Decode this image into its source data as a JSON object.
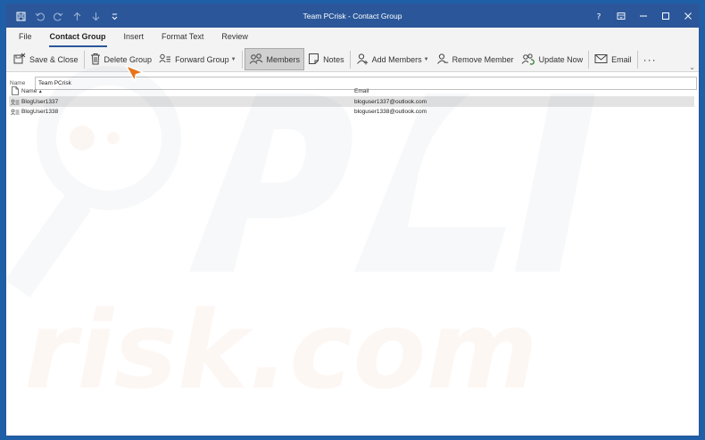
{
  "window": {
    "title": "Team PCrisk  -  Contact Group",
    "controls": [
      "help-icon",
      "ribbon-display-icon",
      "minimize-icon",
      "maximize-icon",
      "close-icon"
    ]
  },
  "quick_access": [
    "save-icon",
    "undo-icon",
    "redo-icon",
    "up-arrow-icon",
    "down-arrow-icon",
    "customize-icon"
  ],
  "tabs": [
    {
      "label": "File"
    },
    {
      "label": "Contact Group",
      "active": true
    },
    {
      "label": "Insert"
    },
    {
      "label": "Format Text"
    },
    {
      "label": "Review"
    }
  ],
  "ribbon": {
    "save_close": "Save & Close",
    "delete_group": "Delete Group",
    "forward_group": "Forward Group",
    "members": "Members",
    "notes": "Notes",
    "add_members": "Add Members",
    "remove_member": "Remove Member",
    "update_now": "Update Now",
    "email": "Email",
    "more": "···"
  },
  "name_field": {
    "label": "Name",
    "value": "Team PCrisk"
  },
  "list": {
    "headers": {
      "name": "Name",
      "email": "Email"
    },
    "rows": [
      {
        "name": "BlogUser1337",
        "email": "bloguser1337@outlook.com",
        "selected": true
      },
      {
        "name": "BlogUser1338",
        "email": "bloguser1338@outlook.com",
        "selected": false
      }
    ]
  },
  "colors": {
    "accent": "#2b579a",
    "ribbon_bg": "#f3f3f3",
    "selected_row": "#e3e3e3",
    "cursor": "#e8731a"
  }
}
